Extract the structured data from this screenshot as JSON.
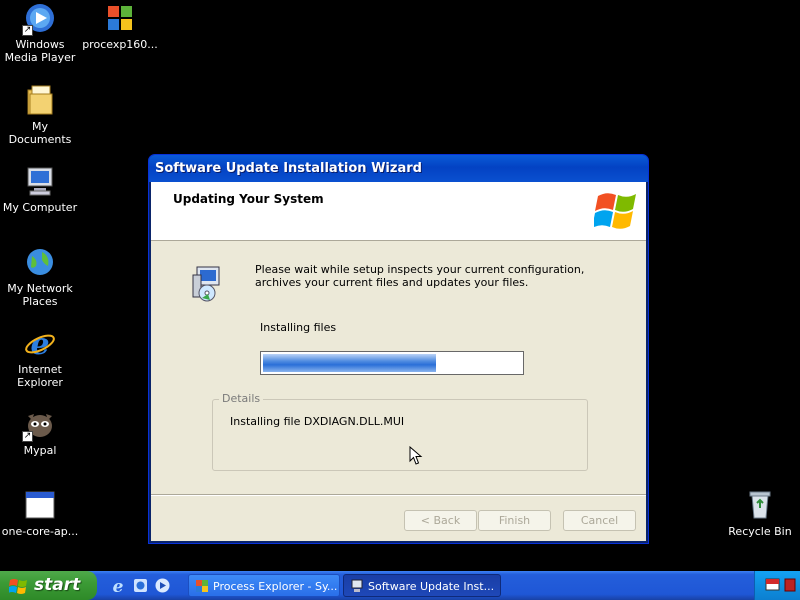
{
  "desktop": {
    "icons": [
      {
        "label": "Windows Media Player",
        "icon": "windows-media-player-icon"
      },
      {
        "label": "procexp160...",
        "icon": "process-explorer-icon"
      },
      {
        "label": "My Documents",
        "icon": "folder-icon"
      },
      {
        "label": "My Computer",
        "icon": "computer-icon"
      },
      {
        "label": "My Network Places",
        "icon": "network-globe-icon"
      },
      {
        "label": "Internet Explorer",
        "icon": "internet-explorer-icon"
      },
      {
        "label": "Mypal",
        "icon": "mypal-icon"
      },
      {
        "label": "one-core-ap...",
        "icon": "application-window-icon"
      },
      {
        "label": "Recycle Bin",
        "icon": "recycle-bin-icon"
      }
    ]
  },
  "wizard": {
    "title": "Software Update Installation Wizard",
    "header_title": "Updating Your System",
    "message": "Please wait while setup inspects your current configuration, archives your current files and updates your files.",
    "status_label": "Installing files",
    "progress_fraction": 0.67,
    "details_legend": "Details",
    "details_text": "Installing file DXDIAGN.DLL.MUI",
    "buttons": {
      "back": "< Back",
      "finish": "Finish",
      "cancel": "Cancel"
    }
  },
  "taskbar": {
    "start_label": "start",
    "tasks": [
      {
        "label": "Process Explorer - Sy...",
        "active": false
      },
      {
        "label": "Software Update Inst...",
        "active": true
      }
    ]
  },
  "colors": {
    "title_bar": "#0342c3",
    "taskbar": "#245edb",
    "start_button": "#3c9b36",
    "progress": "#2a6fd8",
    "dialog_bg": "#ece9d8"
  }
}
